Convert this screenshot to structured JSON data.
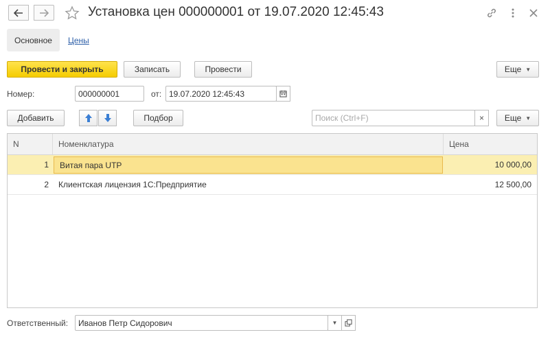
{
  "window": {
    "title": "Установка цен 000000001 от 19.07.2020 12:45:43",
    "icons": [
      "back-arrow-icon",
      "forward-arrow-icon",
      "star-icon",
      "link-icon",
      "more-vertical-icon",
      "close-icon"
    ]
  },
  "tabs": [
    {
      "label": "Основное",
      "active": true
    },
    {
      "label": "Цены",
      "active": false
    }
  ],
  "toolbar": {
    "post_close_label": "Провести и закрыть",
    "save_label": "Записать",
    "post_label": "Провести",
    "more_label": "Еще"
  },
  "header_fields": {
    "number_label": "Номер:",
    "number_value": "000000001",
    "date_label": "от:",
    "date_value": "19.07.2020 12:45:43"
  },
  "table_toolbar": {
    "add_label": "Добавить",
    "select_label": "Подбор",
    "search_placeholder": "Поиск (Ctrl+F)",
    "clear_glyph": "×",
    "more_label": "Еще"
  },
  "table": {
    "columns": [
      "N",
      "Номенклатура",
      "Цена"
    ],
    "rows": [
      {
        "n": "1",
        "name": "Витая пара UTP",
        "price": "10 000,00",
        "selected": true
      },
      {
        "n": "2",
        "name": "Клиентская лицензия 1С:Предприятие",
        "price": "12 500,00",
        "selected": false
      }
    ]
  },
  "footer": {
    "responsible_label": "Ответственный:",
    "responsible_value": "Иванов Петр Сидорович"
  },
  "colors": {
    "primary_button": "#f5cd00",
    "selected_row": "#fbefb2",
    "active_cell": "#fae38f",
    "link": "#2d5fa8"
  }
}
